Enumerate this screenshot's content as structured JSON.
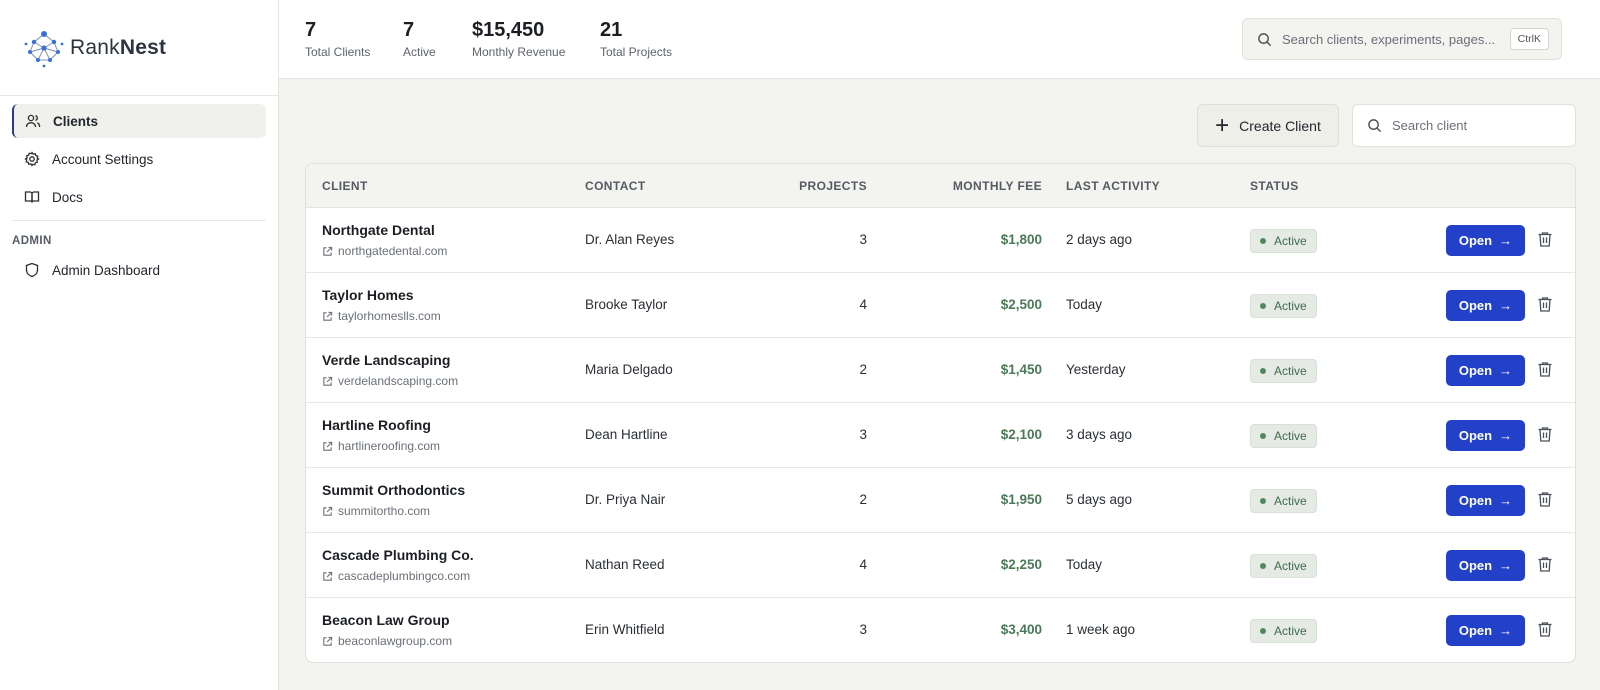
{
  "brand": {
    "name_light": "Rank",
    "name_bold": "Nest"
  },
  "sidebar": {
    "items": [
      {
        "label": "Clients",
        "icon": "users-icon",
        "active": true
      },
      {
        "label": "Account Settings",
        "icon": "gear-icon",
        "active": false
      },
      {
        "label": "Docs",
        "icon": "book-icon",
        "active": false
      }
    ],
    "admin_label": "ADMIN",
    "admin_items": [
      {
        "label": "Admin Dashboard",
        "icon": "shield-icon"
      }
    ]
  },
  "stats": [
    {
      "value": "7",
      "label": "Total Clients"
    },
    {
      "value": "7",
      "label": "Active"
    },
    {
      "value": "$15,450",
      "label": "Monthly Revenue"
    },
    {
      "value": "21",
      "label": "Total Projects"
    }
  ],
  "search": {
    "placeholder": "Search clients, experiments, pages...",
    "shortcut": "CtrlK"
  },
  "toolbar": {
    "create_label": "Create Client",
    "search_placeholder": "Search client"
  },
  "table": {
    "headers": {
      "client": "CLIENT",
      "contact": "CONTACT",
      "projects": "PROJECTS",
      "fee": "MONTHLY FEE",
      "activity": "LAST ACTIVITY",
      "status": "STATUS"
    },
    "open_label": "Open",
    "rows": [
      {
        "name": "Northgate Dental",
        "url": "northgatedental.com",
        "contact": "Dr. Alan Reyes",
        "projects": "3",
        "fee": "$1,800",
        "activity": "2 days ago",
        "status": "Active"
      },
      {
        "name": "Taylor Homes",
        "url": "taylorhomeslls.com",
        "contact": "Brooke Taylor",
        "projects": "4",
        "fee": "$2,500",
        "activity": "Today",
        "status": "Active"
      },
      {
        "name": "Verde Landscaping",
        "url": "verdelandscaping.com",
        "contact": "Maria Delgado",
        "projects": "2",
        "fee": "$1,450",
        "activity": "Yesterday",
        "status": "Active"
      },
      {
        "name": "Hartline Roofing",
        "url": "hartlineroofing.com",
        "contact": "Dean Hartline",
        "projects": "3",
        "fee": "$2,100",
        "activity": "3 days ago",
        "status": "Active"
      },
      {
        "name": "Summit Orthodontics",
        "url": "summitortho.com",
        "contact": "Dr. Priya Nair",
        "projects": "2",
        "fee": "$1,950",
        "activity": "5 days ago",
        "status": "Active"
      },
      {
        "name": "Cascade Plumbing Co.",
        "url": "cascadeplumbingco.com",
        "contact": "Nathan Reed",
        "projects": "4",
        "fee": "$2,250",
        "activity": "Today",
        "status": "Active"
      },
      {
        "name": "Beacon Law Group",
        "url": "beaconlawgroup.com",
        "contact": "Erin Whitfield",
        "projects": "3",
        "fee": "$3,400",
        "activity": "1 week ago",
        "status": "Active"
      }
    ]
  },
  "colors": {
    "accent": "#2340c9",
    "fee": "#4b7a57",
    "status_bg": "#e5ebe4",
    "background": "#f3f3ef"
  }
}
